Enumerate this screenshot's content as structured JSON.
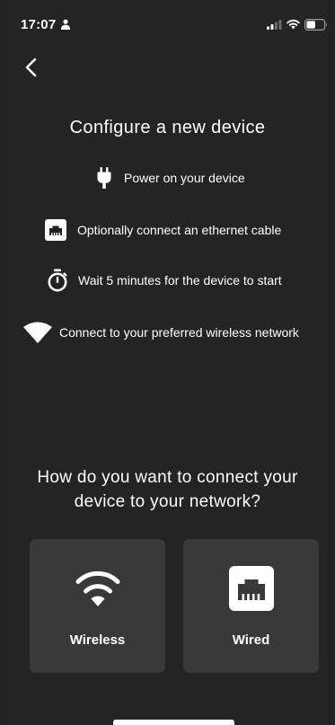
{
  "status_bar": {
    "time": "17:07",
    "icons": [
      "person-icon",
      "signal-icon",
      "wifi-icon",
      "battery-icon"
    ]
  },
  "nav": {
    "back_icon": "chevron-left-icon"
  },
  "title": "Configure a new device",
  "steps": [
    {
      "icon": "plug-icon",
      "text": "Power on your device"
    },
    {
      "icon": "ethernet-port-icon",
      "text": "Optionally connect an ethernet cable"
    },
    {
      "icon": "stopwatch-icon",
      "text": "Wait 5 minutes for the device to start"
    },
    {
      "icon": "wifi-icon",
      "text": "Connect to your preferred wireless network"
    }
  ],
  "question": {
    "line1": "How do you want to connect your",
    "line2": "device to your network?"
  },
  "options": [
    {
      "icon": "wifi-icon",
      "label": "Wireless"
    },
    {
      "icon": "ethernet-port-icon",
      "label": "Wired"
    }
  ],
  "colors": {
    "background": "#242424",
    "card": "#393939",
    "text": "#ffffff"
  }
}
